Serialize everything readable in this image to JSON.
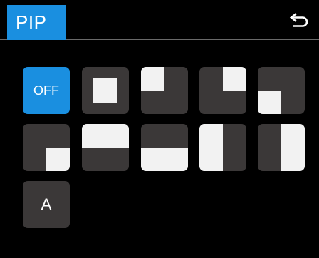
{
  "header": {
    "title": "PIP",
    "back_icon": "return-arrow-icon"
  },
  "pip_modes": [
    {
      "label": "OFF",
      "selected": true
    },
    {
      "icon": "pip-center-icon"
    },
    {
      "icon": "pip-top-left-icon"
    },
    {
      "icon": "pip-top-right-icon"
    },
    {
      "icon": "pip-bottom-left-icon"
    },
    {
      "icon": "pip-bottom-right-icon"
    },
    {
      "icon": "split-horizontal-top-icon"
    },
    {
      "icon": "split-horizontal-bottom-icon"
    },
    {
      "icon": "split-vertical-left-icon"
    },
    {
      "icon": "split-vertical-right-icon"
    },
    {
      "label": "A"
    }
  ],
  "colors": {
    "accent": "#1a8fe0",
    "tile": "#3b3838",
    "shape": "#f2f2f2"
  }
}
